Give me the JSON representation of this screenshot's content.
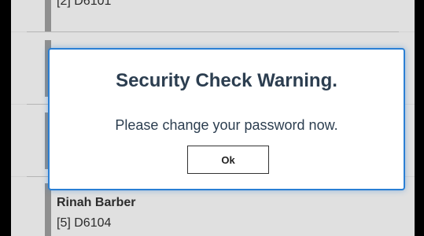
{
  "list": {
    "items": [
      {
        "name": "",
        "code": "[2] D6101"
      },
      {
        "name": "",
        "code": ""
      },
      {
        "name": "",
        "code": ""
      },
      {
        "name": "Rinah Barber",
        "code": "[5] D6104"
      }
    ]
  },
  "dialog": {
    "title": "Security Check Warning.",
    "message": "Please change your password now.",
    "ok_label": "Ok"
  },
  "colors": {
    "dialog_border": "#2a7fd4",
    "text": "#2c3e50"
  }
}
